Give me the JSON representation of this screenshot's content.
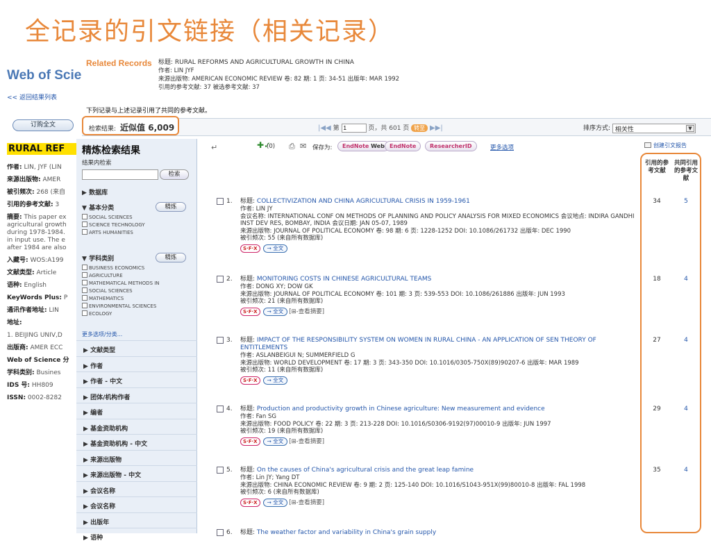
{
  "slide_title": "全记录的引文链接（相关记录）",
  "left": {
    "logo": "Web of Scie",
    "back": "<< 返回结果列表",
    "order_btn": "订购全文",
    "record_title": "RURAL REF",
    "fields": [
      {
        "label": "作者:",
        "value": "LIN, JYF (LIN"
      },
      {
        "label": "来源出版物:",
        "value": "AMER"
      },
      {
        "label": "被引频次:",
        "value": "268 (来自"
      },
      {
        "label": "引用的参考文献:",
        "value": "3"
      }
    ],
    "abstract_label": "摘要:",
    "abstract_lines": [
      "This paper ex",
      "agricultural growth",
      "during 1978-1984.",
      "in input use. The e",
      "after 1984 are also"
    ],
    "fields2": [
      {
        "label": "入藏号:",
        "value": "WOS:A199"
      },
      {
        "label": "文献类型:",
        "value": "Article"
      },
      {
        "label": "语种:",
        "value": "English"
      },
      {
        "label": "KeyWords Plus:",
        "value": "P"
      },
      {
        "label": "通讯作者地址:",
        "value": "LIN"
      },
      {
        "label": "地址:",
        "value": ""
      },
      {
        "label": "",
        "value": "1. BEIJING UNIV,D"
      },
      {
        "label": "出版商:",
        "value": "AMER ECC"
      },
      {
        "label": "Web of Science 分",
        "value": ""
      },
      {
        "label": "学科类别:",
        "value": "Busines"
      },
      {
        "label": "IDS 号:",
        "value": "HH809"
      },
      {
        "label": "ISSN:",
        "value": "0002-8282"
      }
    ]
  },
  "related": {
    "label": "Related Records",
    "title_label": "标题:",
    "title": "RURAL REFORMS AND AGRICULTURAL GROWTH IN CHINA",
    "author_line": "作者: LIN JYF",
    "source_line": "来源出版物: AMERICAN ECONOMIC REVIEW  卷: 82  期: 1  页: 34-51  出版年: MAR 1992",
    "refs_line": "引用的参考文献: 37 被选参考文献: 37",
    "note": "下列记录与上述记录引用了共同的参考文献。"
  },
  "toolbar": {
    "result_label": "检索结果:",
    "result_value": "近似值 6,009",
    "first_icon": "|◀◀",
    "page_label": "第",
    "page_value": "1",
    "page_total": "页，共 601 页",
    "go": "转至",
    "next_icon": "▶▶|",
    "sort_label": "排序方式:",
    "sort_value": "相关性"
  },
  "refine": {
    "title": "精炼检索结果",
    "within": "结果内检索",
    "search_btn": "检索",
    "db": "数据库",
    "basic": "基本分类",
    "refine_btn": "精炼",
    "basic_items": [
      "SOCIAL SCIENCES",
      "SCIENCE TECHNOLOGY",
      "ARTS HUMANITIES"
    ],
    "subject": "学科类别",
    "subject_items": [
      "BUSINESS ECONOMICS",
      "AGRICULTURE",
      "MATHEMATICAL METHODS IN",
      "SOCIAL SCIENCES",
      "MATHEMATICS",
      "ENVIRONMENTAL SCIENCES",
      "ECOLOGY"
    ],
    "more": "更多选项/分类...",
    "facets": [
      "文献类型",
      "作者",
      "作者 - 中文",
      "团体/机构作者",
      "编者",
      "基金资助机构",
      "基金资助机构 - 中文",
      "来源出版物",
      "来源出版物 - 中文",
      "会议名称",
      "会议名称",
      "出版年",
      "语种"
    ]
  },
  "actions": {
    "count": "(0)",
    "save_as": "保存为:",
    "endnote_web_a": "EndNote",
    "endnote_web_b": "Web",
    "endnote": "EndNote",
    "researcherid": "ResearcherID",
    "more_options": "更多选项",
    "create_citation": "创建引文报告",
    "col1": "引用的参考文献",
    "col2": "共同引用的参考文献"
  },
  "records": [
    {
      "num": "1.",
      "title": "COLLECTIVIZATION AND CHINA AGRICULTURAL CRISIS IN 1959-1961",
      "lines": [
        "作者: LIN JY",
        "会议名称: INTERNATIONAL CONF ON METHODS OF PLANNING AND POLICY ANALYSIS FOR MIXED ECONOMICS 会议地点: INDIRA GANDHI",
        "INST DEV RES, BOMBAY, INDIA 会议日期: JAN 05-07, 1989",
        "来源出版物: JOURNAL OF POLITICAL ECONOMY  卷: 98  期: 6  页: 1228-1252  DOI: 10.1086/261732  出版年: DEC 1990",
        "被引频次: 55 (来自所有数据库)"
      ],
      "abstract": "",
      "cited": "34",
      "shared": "5"
    },
    {
      "num": "2.",
      "title": "MONITORING COSTS IN CHINESE AGRICULTURAL TEAMS",
      "lines": [
        "作者: DONG XY; DOW GK",
        "来源出版物: JOURNAL OF POLITICAL ECONOMY  卷: 101  期: 3  页: 539-553  DOI: 10.1086/261886  出版年: JUN 1993",
        "被引频次: 21 (来自所有数据库)"
      ],
      "abstract": "[⊞-查看摘要]",
      "cited": "18",
      "shared": "4"
    },
    {
      "num": "3.",
      "title": "IMPACT OF THE RESPONSIBILITY SYSTEM ON WOMEN IN RURAL CHINA - AN APPLICATION OF SEN THEORY OF ENTITLEMENTS",
      "lines": [
        "作者: ASLANBEIGUI N; SUMMERFIELD G",
        "来源出版物: WORLD DEVELOPMENT  卷: 17  期: 3  页: 343-350  DOI: 10.1016/0305-750X(89)90207-6  出版年: MAR 1989",
        "被引频次: 11 (来自所有数据库)"
      ],
      "abstract": "",
      "cited": "27",
      "shared": "4"
    },
    {
      "num": "4.",
      "title": "Production and productivity growth in Chinese agriculture: New measurement and evidence",
      "lines": [
        "作者: Fan SG",
        "来源出版物: FOOD POLICY  卷: 22  期: 3  页: 213-228  DOI: 10.1016/S0306-9192(97)00010-9  出版年: JUN 1997",
        "被引频次: 19 (来自所有数据库)"
      ],
      "abstract": "[⊞-查看摘要]",
      "cited": "29",
      "shared": "4"
    },
    {
      "num": "5.",
      "title": "On the causes of China's agricultural crisis and the great leap famine",
      "lines": [
        "作者: Lin JY; Yang DT",
        "来源出版物: CHINA ECONOMIC REVIEW  卷: 9  期: 2  页: 125-140  DOI: 10.1016/S1043-951X(99)80010-8  出版年: FAL 1998",
        "被引频次: 6 (来自所有数据库)"
      ],
      "abstract": "[⊞-查看摘要]",
      "cited": "35",
      "shared": "4"
    },
    {
      "num": "6.",
      "title": "The weather factor and variability in China's grain supply",
      "lines": [],
      "abstract": "",
      "cited": "",
      "shared": ""
    }
  ],
  "sfx_label": "S·F·X",
  "fulltext_label": "→ 全文",
  "title_prefix": "标题:"
}
